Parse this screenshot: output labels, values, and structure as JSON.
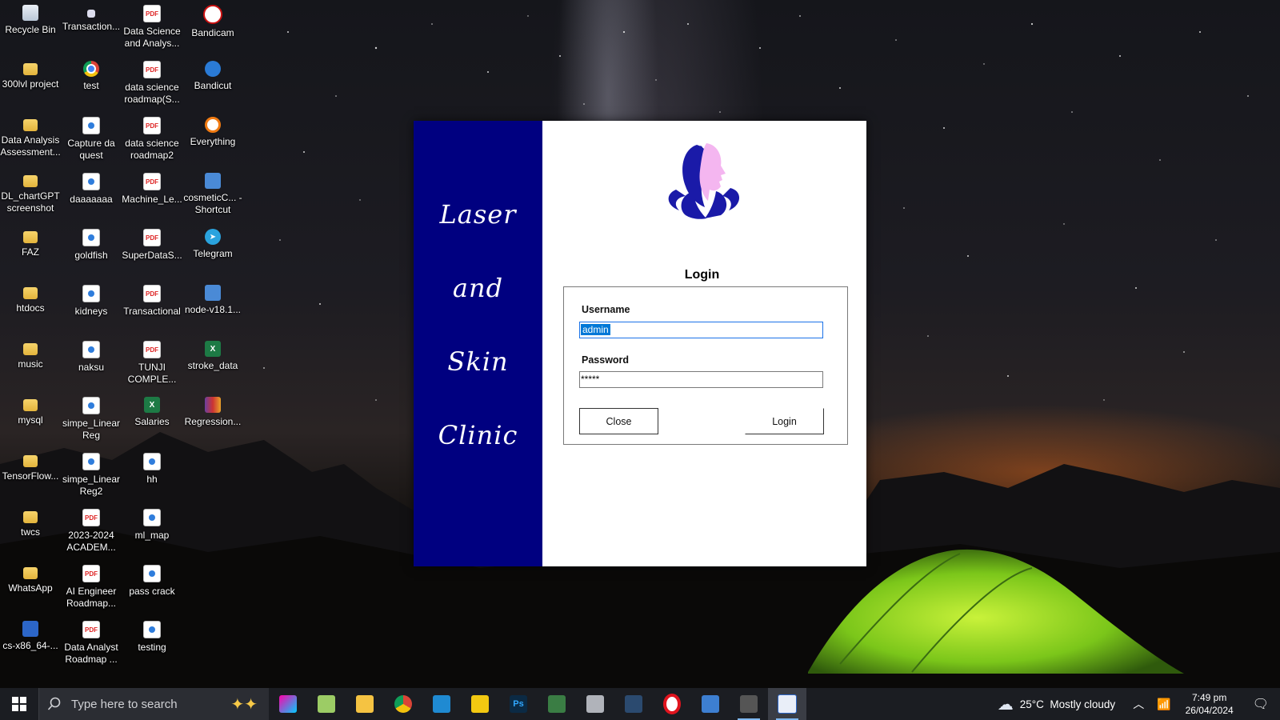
{
  "desktop": {
    "icons": [
      {
        "label": "Recycle Bin",
        "icon": "recycle-bin-icon"
      },
      {
        "label": "Transaction...",
        "icon": "shortcut-icon"
      },
      {
        "label": "Data Science and Analys...",
        "icon": "pdf-icon"
      },
      {
        "label": "Bandicam",
        "icon": "bandicam-icon"
      },
      {
        "label": "300lvl project",
        "icon": "folder-icon"
      },
      {
        "label": "test",
        "icon": "chrome-icon"
      },
      {
        "label": "data science roadmap(S...",
        "icon": "pdf-icon"
      },
      {
        "label": "Bandicut",
        "icon": "bandicut-icon"
      },
      {
        "label": "Data Analysis Assessment...",
        "icon": "folder-icon"
      },
      {
        "label": "Capture da quest",
        "icon": "image-icon"
      },
      {
        "label": "data science roadmap2",
        "icon": "pdf-icon"
      },
      {
        "label": "Everything",
        "icon": "everything-search-icon"
      },
      {
        "label": "DL_chartGPT screenshot",
        "icon": "folder-icon"
      },
      {
        "label": "daaaaaaa",
        "icon": "image-icon"
      },
      {
        "label": "Machine_Le...",
        "icon": "pdf-icon"
      },
      {
        "label": "cosmeticC... - Shortcut",
        "icon": "app-shortcut-icon"
      },
      {
        "label": "FAZ",
        "icon": "folder-icon"
      },
      {
        "label": "goldfish",
        "icon": "image-icon"
      },
      {
        "label": "SuperDataS...",
        "icon": "pdf-icon"
      },
      {
        "label": "Telegram",
        "icon": "telegram-icon"
      },
      {
        "label": "htdocs",
        "icon": "folder-icon"
      },
      {
        "label": "kidneys",
        "icon": "image-icon"
      },
      {
        "label": "Transactional",
        "icon": "pdf-icon"
      },
      {
        "label": "node-v18.1...",
        "icon": "installer-icon"
      },
      {
        "label": "music",
        "icon": "folder-icon"
      },
      {
        "label": "naksu",
        "icon": "image-icon"
      },
      {
        "label": "TUNJI COMPLE...",
        "icon": "pdf-icon"
      },
      {
        "label": "stroke_data",
        "icon": "excel-icon"
      },
      {
        "label": "mysql",
        "icon": "folder-icon"
      },
      {
        "label": "simpe_Linear Reg",
        "icon": "image-icon"
      },
      {
        "label": "Salaries",
        "icon": "excel-icon"
      },
      {
        "label": "Regression...",
        "icon": "winrar-icon"
      },
      {
        "label": "TensorFlow...",
        "icon": "folder-icon"
      },
      {
        "label": "simpe_Linear Reg2",
        "icon": "image-icon"
      },
      {
        "label": "hh",
        "icon": "image-icon"
      },
      {
        "label": "twcs",
        "icon": "folder-icon"
      },
      {
        "label": "2023-2024 ACADEM...",
        "icon": "pdf-icon"
      },
      {
        "label": "ml_map",
        "icon": "image-icon"
      },
      {
        "label": "WhatsApp",
        "icon": "folder-icon"
      },
      {
        "label": "AI Engineer Roadmap...",
        "icon": "pdf-icon"
      },
      {
        "label": "pass crack",
        "icon": "image-icon"
      },
      {
        "label": "cs-x86_64-...",
        "icon": "app-icon"
      },
      {
        "label": "Data Analyst Roadmap ...",
        "icon": "pdf-icon"
      },
      {
        "label": "testing",
        "icon": "image-icon"
      }
    ]
  },
  "app": {
    "side_words": [
      "Laser",
      "and",
      "Skin",
      "Clinic"
    ],
    "logo_icon": "woman-face-flower-logo",
    "login_title": "Login",
    "username_label": "Username",
    "username_value": "admin",
    "password_label": "Password",
    "password_value": "*****",
    "close_label": "Close",
    "login_label": "Login",
    "colors": {
      "side_panel": "#000080",
      "logo_primary": "#1a1aa8",
      "logo_face": "#f4b6f0"
    }
  },
  "taskbar": {
    "search_placeholder": "Type here to search",
    "apps": [
      {
        "name": "copilot-paint-icon"
      },
      {
        "name": "notepad-plus-icon"
      },
      {
        "name": "file-explorer-icon"
      },
      {
        "name": "chrome-icon"
      },
      {
        "name": "vscode-icon"
      },
      {
        "name": "power-bi-icon"
      },
      {
        "name": "photoshop-icon",
        "text": "Ps"
      },
      {
        "name": "anaconda-icon"
      },
      {
        "name": "database-icon"
      },
      {
        "name": "mysql-workbench-icon"
      },
      {
        "name": "opera-icon"
      },
      {
        "name": "remote-desktop-icon"
      },
      {
        "name": "pen-tool-icon"
      },
      {
        "name": "winforms-app-icon"
      }
    ],
    "weather": "25°C  Mostly cloudy",
    "time": "7:49 pm",
    "date": "26/04/2024"
  }
}
